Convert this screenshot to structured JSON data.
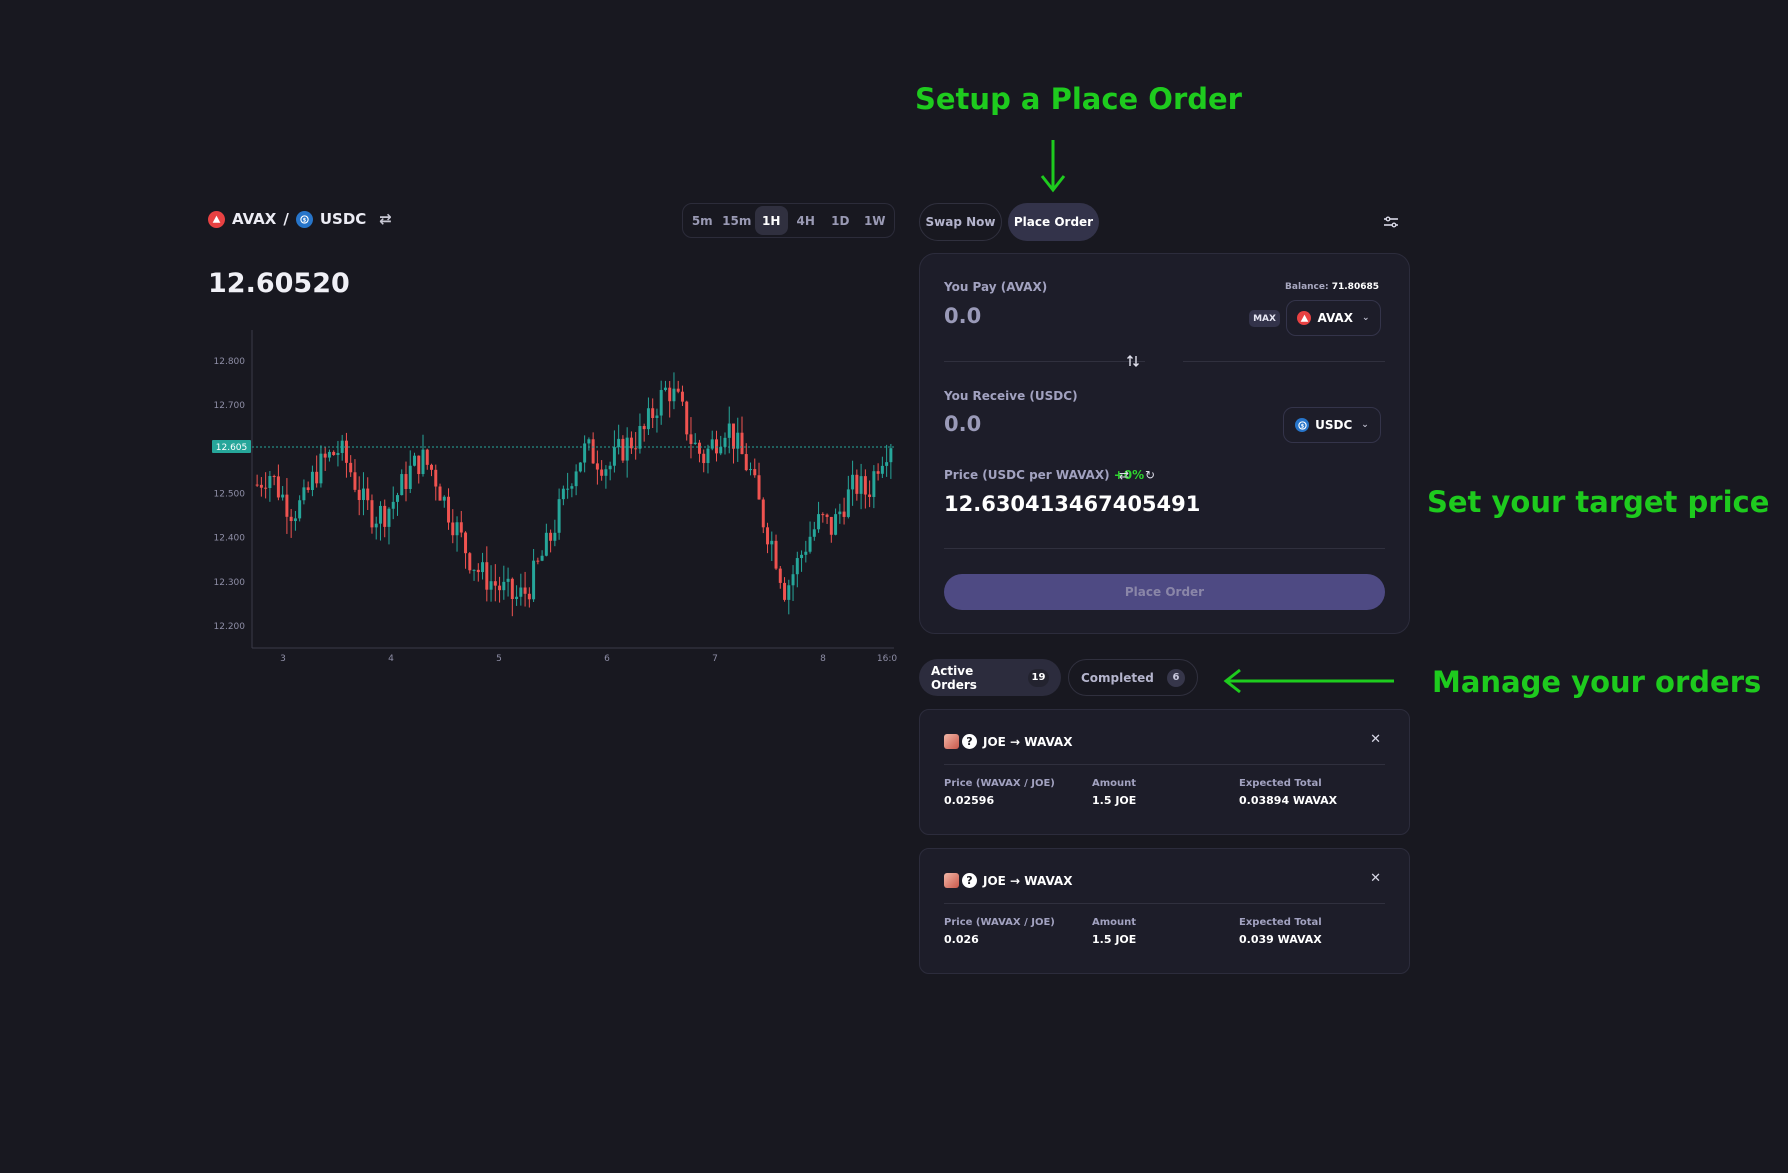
{
  "annotations": {
    "setup": "Setup a Place Order",
    "target": "Set your target price",
    "manage": "Manage your orders"
  },
  "pair": {
    "base": "AVAX",
    "separator": "/",
    "quote": "USDC",
    "last_price": "12.60520"
  },
  "timeframes": [
    {
      "label": "5m",
      "active": false
    },
    {
      "label": "15m",
      "active": false
    },
    {
      "label": "1H",
      "active": true
    },
    {
      "label": "4H",
      "active": false
    },
    {
      "label": "1D",
      "active": false
    },
    {
      "label": "1W",
      "active": false
    }
  ],
  "chart_data": {
    "type": "candlestick",
    "y_ticks": [
      "12.800",
      "12.700",
      "12.500",
      "12.400",
      "12.300",
      "12.200"
    ],
    "ylim": [
      12.15,
      12.87
    ],
    "x_ticks": [
      "3",
      "4",
      "5",
      "6",
      "7",
      "8",
      "16:0"
    ],
    "current_price_label": "12.605",
    "current_price": 12.605,
    "colors": {
      "up": "#26a69a",
      "down": "#ef5350"
    },
    "close_path": [
      12.52,
      12.55,
      12.5,
      12.46,
      12.48,
      12.55,
      12.58,
      12.6,
      12.55,
      12.48,
      12.45,
      12.46,
      12.5,
      12.55,
      12.58,
      12.55,
      12.48,
      12.42,
      12.36,
      12.32,
      12.3,
      12.28,
      12.26,
      12.28,
      12.34,
      12.4,
      12.48,
      12.56,
      12.6,
      12.58,
      12.56,
      12.6,
      12.62,
      12.64,
      12.7,
      12.74,
      12.7,
      12.62,
      12.58,
      12.62,
      12.66,
      12.6,
      12.55,
      12.45,
      12.38,
      12.28,
      12.34,
      12.4,
      12.44,
      12.42,
      12.48,
      12.52,
      12.5,
      12.58,
      12.62
    ]
  },
  "order_tabs": {
    "swap": "Swap Now",
    "place": "Place Order"
  },
  "panel": {
    "pay_label": "You Pay (AVAX)",
    "balance_label": "Balance:",
    "balance_value": "71.80685",
    "pay_value": "0.0",
    "max_label": "MAX",
    "pay_token": "AVAX",
    "receive_label": "You Receive (USDC)",
    "receive_value": "0.0",
    "receive_token": "USDC",
    "price_label": "Price (USDC per WAVAX)",
    "price_change": "+0%",
    "target_price": "12.630413467405491",
    "submit_label": "Place Order"
  },
  "orders_tabs": {
    "active_label": "Active Orders",
    "active_count": "19",
    "completed_label": "Completed",
    "completed_count": "6"
  },
  "orders": [
    {
      "pair": "JOE → WAVAX",
      "price_label": "Price (WAVAX / JOE)",
      "price": "0.02596",
      "amount_label": "Amount",
      "amount": "1.5 JOE",
      "total_label": "Expected Total",
      "total": "0.03894 WAVAX"
    },
    {
      "pair": "JOE → WAVAX",
      "price_label": "Price (WAVAX / JOE)",
      "price": "0.026",
      "amount_label": "Amount",
      "amount": "1.5 JOE",
      "total_label": "Expected Total",
      "total": "0.039 WAVAX"
    }
  ],
  "icons": {
    "close": "close-icon",
    "settings": "settings-icon",
    "flip": "swap-vertical-icon",
    "invert": "swap-horizontal-icon",
    "refresh": "refresh-icon"
  }
}
